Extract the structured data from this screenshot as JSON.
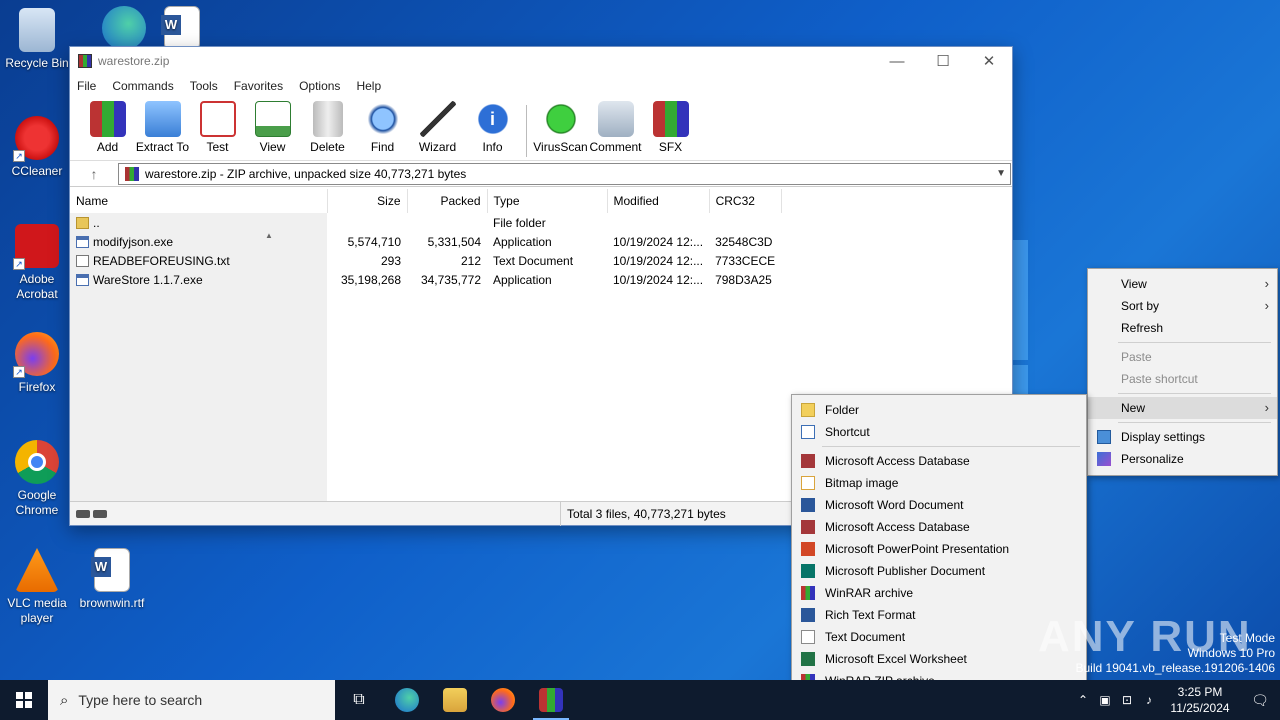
{
  "desktop": {
    "icons": [
      {
        "label": "Recycle Bin"
      },
      {
        "label": "CCleaner"
      },
      {
        "label": "Adobe Acrobat"
      },
      {
        "label": "Firefox"
      },
      {
        "label": "Google Chrome"
      },
      {
        "label": "VLC media player"
      },
      {
        "label": "brownwin.rtf"
      }
    ]
  },
  "window": {
    "title": "warestore.zip",
    "menu": [
      "File",
      "Commands",
      "Tools",
      "Favorites",
      "Options",
      "Help"
    ],
    "toolbar": [
      "Add",
      "Extract To",
      "Test",
      "View",
      "Delete",
      "Find",
      "Wizard",
      "Info",
      "VirusScan",
      "Comment",
      "SFX"
    ],
    "address": "warestore.zip - ZIP archive, unpacked size 40,773,271 bytes",
    "columns": {
      "name": "Name",
      "size": "Size",
      "packed": "Packed",
      "type": "Type",
      "modified": "Modified",
      "crc": "CRC32"
    },
    "rows": [
      {
        "name": "..",
        "size": "",
        "packed": "",
        "type": "File folder",
        "modified": "",
        "crc": "",
        "icon": "folder-icon"
      },
      {
        "name": "modifyjson.exe",
        "size": "5,574,710",
        "packed": "5,331,504",
        "type": "Application",
        "modified": "10/19/2024 12:...",
        "crc": "32548C3D",
        "icon": "exe-icon"
      },
      {
        "name": "READBEFOREUSING.txt",
        "size": "293",
        "packed": "212",
        "type": "Text Document",
        "modified": "10/19/2024 12:...",
        "crc": "7733CECE",
        "icon": "text-file-icon"
      },
      {
        "name": "WareStore 1.1.7.exe",
        "size": "35,198,268",
        "packed": "34,735,772",
        "type": "Application",
        "modified": "10/19/2024 12:...",
        "crc": "798D3A25",
        "icon": "exe-icon"
      }
    ],
    "status": "Total 3 files, 40,773,271 bytes"
  },
  "context_menu": {
    "items": [
      {
        "label": "View",
        "submenu": true
      },
      {
        "label": "Sort by",
        "submenu": true
      },
      {
        "label": "Refresh"
      },
      {
        "label": "Paste",
        "disabled": true
      },
      {
        "label": "Paste shortcut",
        "disabled": true
      },
      {
        "label": "New",
        "submenu": true
      },
      {
        "label": "Display settings"
      },
      {
        "label": "Personalize"
      }
    ]
  },
  "new_submenu": {
    "items": [
      {
        "label": "Folder",
        "color": "#f2cf5b"
      },
      {
        "label": "Shortcut",
        "color": "#3c6fb5"
      },
      {
        "label": "Microsoft Access Database",
        "color": "#a4373a"
      },
      {
        "label": "Bitmap image",
        "color": "#d9a43c"
      },
      {
        "label": "Microsoft Word Document",
        "color": "#2b579a"
      },
      {
        "label": "Microsoft Access Database",
        "color": "#a4373a"
      },
      {
        "label": "Microsoft PowerPoint Presentation",
        "color": "#d24726"
      },
      {
        "label": "Microsoft Publisher Document",
        "color": "#077568"
      },
      {
        "label": "WinRAR archive",
        "color": "#7a3f9e"
      },
      {
        "label": "Rich Text Format",
        "color": "#2b579a"
      },
      {
        "label": "Text Document",
        "color": "#8a8a8a"
      },
      {
        "label": "Microsoft Excel Worksheet",
        "color": "#217346"
      },
      {
        "label": "WinRAR ZIP archive",
        "color": "#7a3f9e"
      }
    ]
  },
  "taskbar": {
    "search_placeholder": "Type here to search",
    "time": "3:25 PM",
    "date": "11/25/2024"
  },
  "overlay": {
    "watermark": "ANY RUN",
    "testmode": [
      "Test Mode",
      "Windows 10 Pro",
      "Build 19041.vb_release.191206-1406"
    ]
  }
}
